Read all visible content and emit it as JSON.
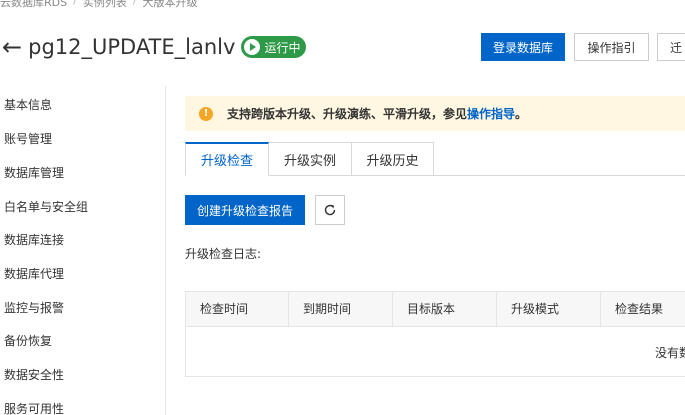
{
  "breadcrumb": [
    "云数据库RDS",
    "实例列表",
    "大版本升级"
  ],
  "header": {
    "title": "pg12_UPDATE_lanlv",
    "status": "运行中",
    "status_color": "#2e9a47"
  },
  "actions": {
    "login_db": "登录数据库",
    "guide": "操作指引",
    "migrate_partial": "迁"
  },
  "sidebar": {
    "items": [
      "基本信息",
      "账号管理",
      "数据库管理",
      "白名单与安全组",
      "数据库连接",
      "数据库代理",
      "监控与报警",
      "备份恢复",
      "数据安全性",
      "服务可用性"
    ]
  },
  "notice": {
    "text": "支持跨版本升级、升级演练、平滑升级，参见",
    "link": "操作指导",
    "suffix": "。"
  },
  "tabs": [
    {
      "label": "升级检查",
      "active": true
    },
    {
      "label": "升级实例",
      "active": false
    },
    {
      "label": "升级历史",
      "active": false
    }
  ],
  "toolbar": {
    "create_report": "创建升级检查报告",
    "refresh_icon": "refresh-icon"
  },
  "log_label": "升级检查日志:",
  "table": {
    "columns": [
      "检查时间",
      "到期时间",
      "目标版本",
      "升级模式",
      "检查结果"
    ],
    "empty_text": "没有数"
  },
  "colors": {
    "primary": "#0064c8",
    "notice_bg": "#fff7e1",
    "warning": "#f5a623"
  }
}
